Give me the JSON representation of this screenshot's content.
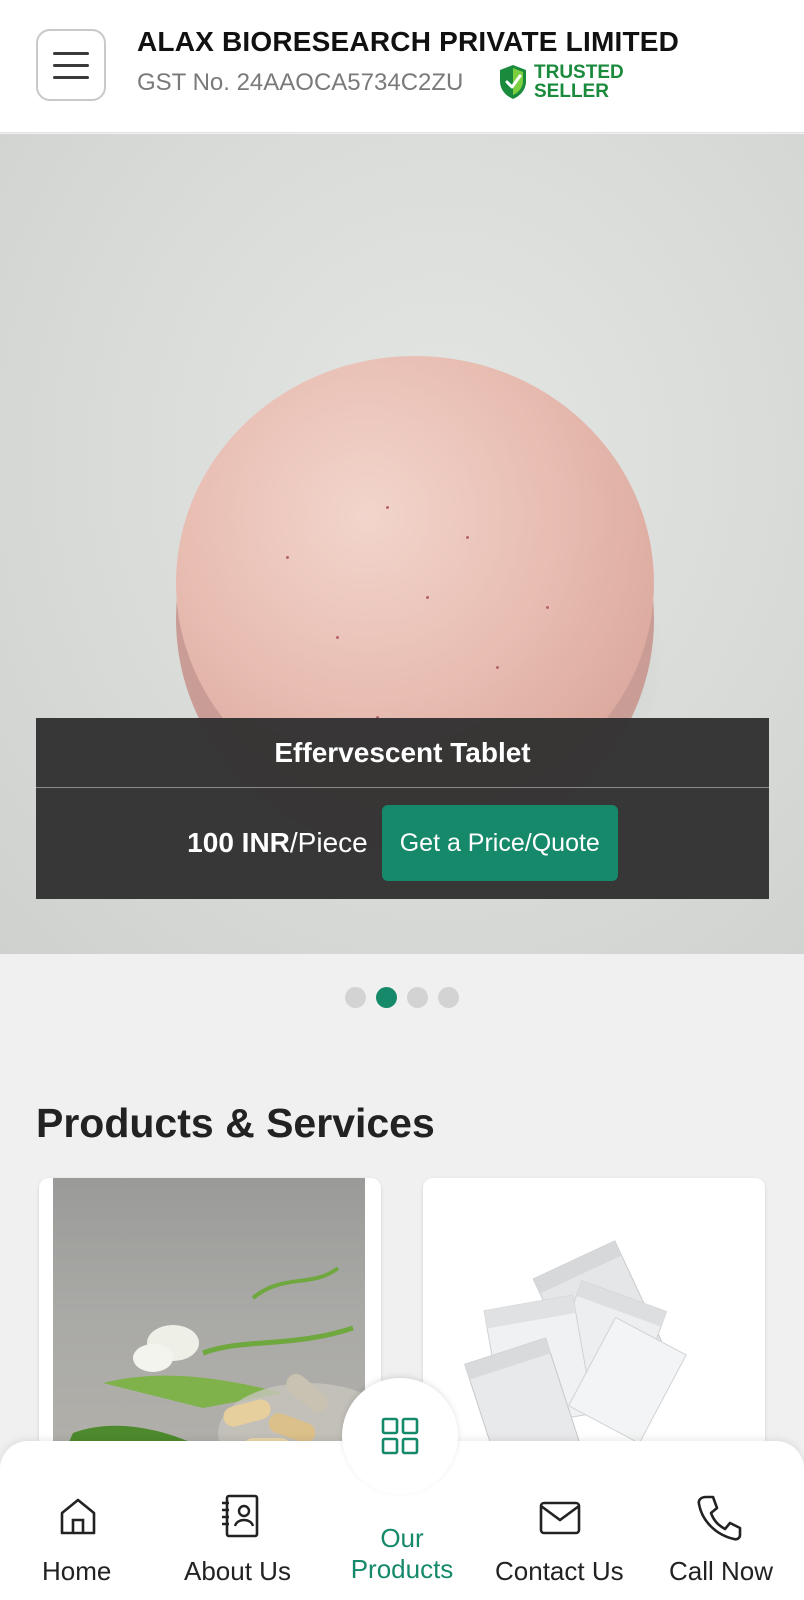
{
  "header": {
    "company_name": "ALAX BIORESEARCH PRIVATE LIMITED",
    "gst": "GST No. 24AAOCA5734C2ZU",
    "badge_line1": "TRUSTED",
    "badge_line2": "SELLER",
    "menu_icon": "hamburger-menu-icon",
    "badge_icon": "shield-check-icon"
  },
  "hero": {
    "product_name": "Effervescent Tablet",
    "price_value": "100 INR",
    "price_unit": "/Piece",
    "quote_button": "Get a Price/Quote",
    "slide_count": 4,
    "active_slide": 2
  },
  "products": {
    "title": "Products & Services"
  },
  "bottom_nav": {
    "items": [
      {
        "label": "Home",
        "icon": "home-icon"
      },
      {
        "label": "About Us",
        "icon": "contact-book-icon"
      },
      {
        "label": "Our Products",
        "line1": "Our",
        "line2": "Products",
        "icon": "grid-icon"
      },
      {
        "label": "Contact Us",
        "icon": "envelope-icon"
      },
      {
        "label": "Call Now",
        "icon": "phone-icon"
      }
    ]
  },
  "colors": {
    "accent": "#16896b",
    "trusted_green": "#1a8a3c",
    "caption_bg": "#323232"
  }
}
